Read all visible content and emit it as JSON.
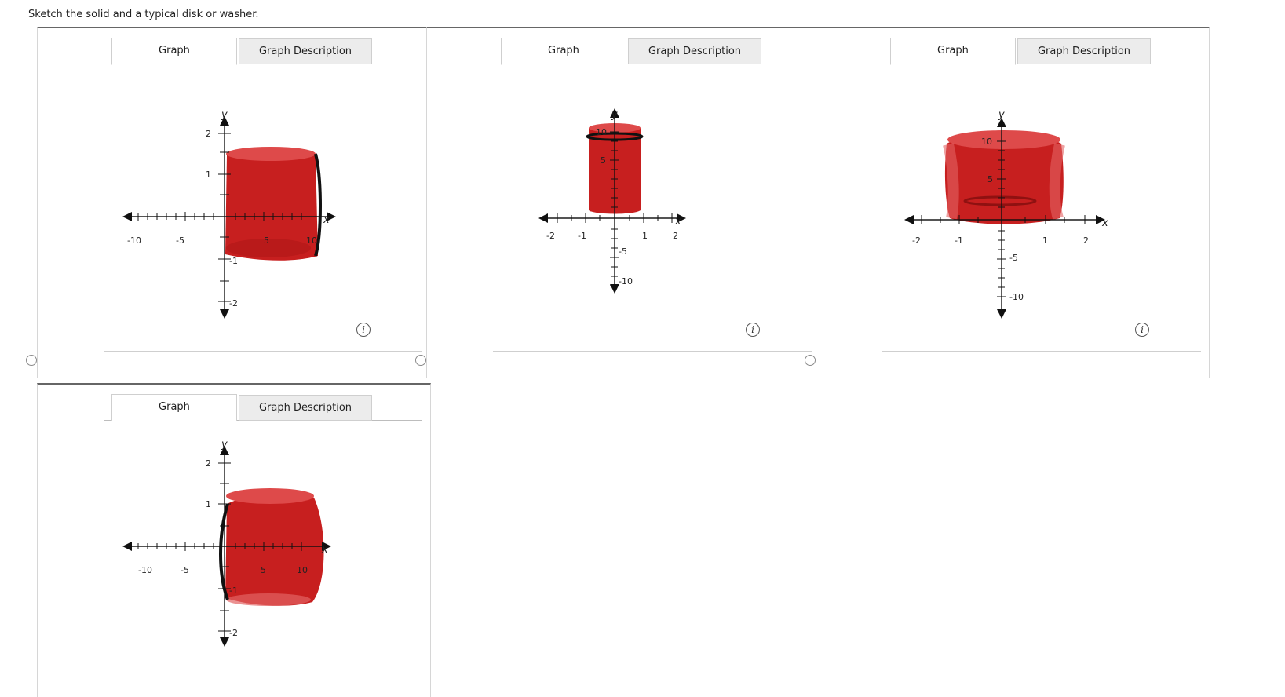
{
  "prompt": "Sketch the solid and a typical disk or washer.",
  "tabs": {
    "graph": "Graph",
    "description": "Graph Description"
  },
  "info_icon": "info-icon",
  "axis_labels": {
    "x": "x",
    "y": "y"
  },
  "options": [
    {
      "xticks": [
        "-10",
        "-5",
        "5",
        "10"
      ],
      "yticks": [
        "2",
        "1",
        "-1",
        "-2"
      ]
    },
    {
      "xticks": [
        "-2",
        "-1",
        "1",
        "2"
      ],
      "yticks": [
        "10",
        "5",
        "-5",
        "-10"
      ]
    },
    {
      "xticks": [
        "-2",
        "-1",
        "1",
        "2"
      ],
      "yticks": [
        "10",
        "5",
        "-5",
        "-10"
      ]
    },
    {
      "xticks": [
        "-10",
        "-5",
        "5",
        "10"
      ],
      "yticks": [
        "2",
        "1",
        "-1",
        "-2"
      ]
    }
  ],
  "colors": {
    "solid": "#cc1f1f",
    "solid_dark": "#a31515",
    "axis": "#111111"
  }
}
